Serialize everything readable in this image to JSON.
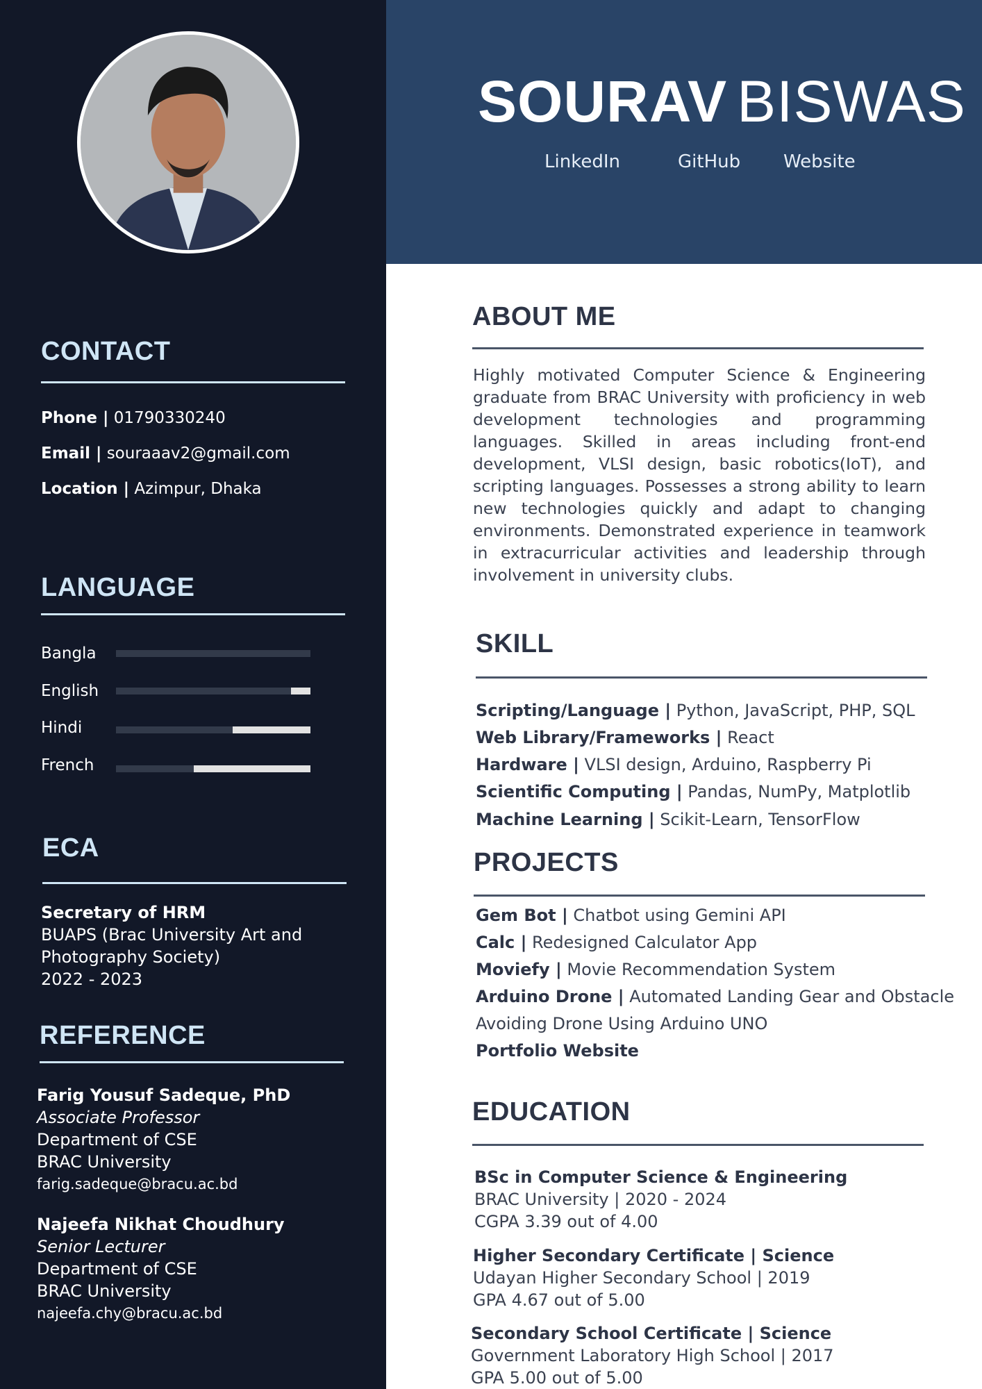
{
  "header": {
    "first_name": "SOURAV",
    "last_name": "BISWAS",
    "links": [
      "LinkedIn",
      "GitHub",
      "Website"
    ]
  },
  "contact": {
    "heading": "CONTACT",
    "phone_label": "Phone |",
    "phone": "01790330240",
    "email_label": "Email |",
    "email": "souraaav2@gmail.com",
    "location_label": "Location |",
    "location": "Azimpur, Dhaka"
  },
  "language": {
    "heading": "LANGUAGE",
    "items": [
      {
        "name": "Bangla",
        "level": 1.0
      },
      {
        "name": "English",
        "level": 0.9
      },
      {
        "name": "Hindi",
        "level": 0.6
      },
      {
        "name": "French",
        "level": 0.4
      }
    ]
  },
  "eca": {
    "heading": "ECA",
    "role": "Secretary of HRM",
    "org": "BUAPS (Brac University Art and Photography Society)",
    "years": "2022 - 2023"
  },
  "reference": {
    "heading": "REFERENCE",
    "people": [
      {
        "name": "Farig Yousuf Sadeque, PhD",
        "title": "Associate Professor",
        "dept": "Department of CSE",
        "org": "BRAC University",
        "email": "farig.sadeque@bracu.ac.bd"
      },
      {
        "name": "Najeefa Nikhat Choudhury",
        "title": "Senior Lecturer",
        "dept": "Department of CSE",
        "org": "BRAC University",
        "email": "najeefa.chy@bracu.ac.bd"
      }
    ]
  },
  "about": {
    "heading": "ABOUT ME",
    "text": "Highly motivated Computer Science & Engineering graduate from BRAC University with proficiency in web development technologies and programming languages. Skilled in areas including front-end development, VLSI design, basic robotics(IoT), and scripting languages. Possesses a strong ability to learn new technologies quickly and adapt to changing environments. Demonstrated experience in teamwork in extracurricular activities and leadership through involvement in university clubs."
  },
  "skill": {
    "heading": "SKILL",
    "items": [
      {
        "label": "Scripting/Language |",
        "value": "Python, JavaScript, PHP, SQL"
      },
      {
        "label": "Web Library/Frameworks |",
        "value": "React"
      },
      {
        "label": "Hardware |",
        "value": "VLSI design, Arduino, Raspberry Pi"
      },
      {
        "label": "Scientific Computing |",
        "value": "Pandas, NumPy, Matplotlib"
      },
      {
        "label": "Machine Learning |",
        "value": "Scikit-Learn, TensorFlow"
      }
    ]
  },
  "projects": {
    "heading": "PROJECTS",
    "items": [
      {
        "label": "Gem Bot |",
        "value": "Chatbot using Gemini API"
      },
      {
        "label": "Calc |",
        "value": "Redesigned Calculator App"
      },
      {
        "label": "Moviefy |",
        "value": "Movie Recommendation System"
      },
      {
        "label": "Arduino Drone |",
        "value": "Automated Landing Gear and Obstacle"
      },
      {
        "label": "",
        "value": "Avoiding Drone Using Arduino UNO"
      },
      {
        "label": "Portfolio Website",
        "value": ""
      }
    ]
  },
  "education": {
    "heading": "EDUCATION",
    "items": [
      {
        "degree": "BSc in Computer Science & Engineering",
        "school": "BRAC University | 2020 - 2024",
        "grade": "CGPA 3.39 out of 4.00"
      },
      {
        "degree": "Higher Secondary Certificate | Science",
        "school": "Udayan Higher Secondary School | 2019",
        "grade": "GPA 4.67 out of 5.00"
      },
      {
        "degree": "Secondary School Certificate | Science",
        "school": "Government Laboratory High School | 2017",
        "grade": "GPA 5.00 out of 5.00"
      }
    ]
  }
}
